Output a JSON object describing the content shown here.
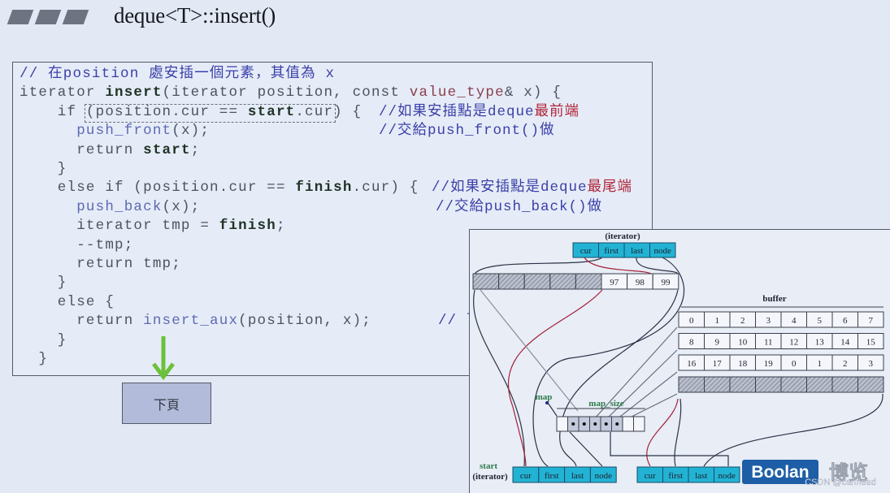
{
  "slide": {
    "title": "deque<T>::insert()",
    "next_button_label": "下頁"
  },
  "code": {
    "lines": [
      {
        "segs": [
          {
            "t": "// 在position 處安插一個元素，其值為 x",
            "c": "cm"
          }
        ]
      },
      {
        "segs": [
          {
            "t": "iterator "
          },
          {
            "t": "insert",
            "c": "b"
          },
          {
            "t": "(iterator position, const "
          },
          {
            "t": "value_type",
            "c": "ty"
          },
          {
            "t": "& x) {"
          }
        ]
      },
      {
        "segs": [
          {
            "t": "    if (position.cur == "
          },
          {
            "t": "start",
            "c": "b"
          },
          {
            "t": ".cur) {"
          }
        ],
        "comment": [
          {
            "t": "//如果安插點是deque"
          },
          {
            "t": "最前端",
            "c": "cmr"
          }
        ]
      },
      {
        "segs": [
          {
            "t": "      "
          },
          {
            "t": "push_front",
            "c": "fn"
          },
          {
            "t": "(x);"
          }
        ],
        "comment": [
          {
            "t": "//交給push_front()做"
          }
        ]
      },
      {
        "segs": [
          {
            "t": "      return "
          },
          {
            "t": "start",
            "c": "b"
          },
          {
            "t": ";"
          }
        ]
      },
      {
        "segs": [
          {
            "t": "    }"
          }
        ]
      },
      {
        "segs": [
          {
            "t": "    else if (position.cur == "
          },
          {
            "t": "finish",
            "c": "b"
          },
          {
            "t": ".cur) {"
          }
        ],
        "comment": [
          {
            "t": "//如果安插點是deque"
          },
          {
            "t": "最尾端",
            "c": "cmr"
          }
        ]
      },
      {
        "segs": [
          {
            "t": "      "
          },
          {
            "t": "push_back",
            "c": "fn"
          },
          {
            "t": "(x);"
          }
        ],
        "comment": [
          {
            "t": "//交給push_back()做"
          }
        ]
      },
      {
        "segs": [
          {
            "t": "      iterator tmp = "
          },
          {
            "t": "finish",
            "c": "b"
          },
          {
            "t": ";"
          }
        ]
      },
      {
        "segs": [
          {
            "t": "      --tmp;"
          }
        ]
      },
      {
        "segs": [
          {
            "t": "      return tmp;"
          }
        ]
      },
      {
        "segs": [
          {
            "t": "    }"
          }
        ]
      },
      {
        "segs": [
          {
            "t": "    else {"
          }
        ]
      },
      {
        "segs": [
          {
            "t": "      return "
          },
          {
            "t": "insert_aux",
            "c": "fn"
          },
          {
            "t": "(position, x);"
          }
        ],
        "comment": [
          {
            "t": "// 了"
          }
        ]
      },
      {
        "segs": [
          {
            "t": "    }"
          }
        ]
      },
      {
        "segs": [
          {
            "t": "  }"
          }
        ]
      }
    ]
  },
  "diagram": {
    "top_iterator_label": "(iterator)",
    "iterator_fields": [
      "cur",
      "first",
      "last",
      "node"
    ],
    "top_buffer_values": [
      "",
      "",
      "",
      "",
      "",
      "97",
      "98",
      "99"
    ],
    "top_buffer_hatched": [
      true,
      true,
      true,
      true,
      true,
      false,
      false,
      false
    ],
    "buffer_label": "buffer",
    "buffer_rows": [
      [
        "0",
        "1",
        "2",
        "3",
        "4",
        "5",
        "6",
        "7"
      ],
      [
        "8",
        "9",
        "10",
        "11",
        "12",
        "13",
        "14",
        "15"
      ],
      [
        "16",
        "17",
        "18",
        "19",
        "0",
        "1",
        "2",
        "3"
      ]
    ],
    "map_label": "map",
    "map_size_label": "map_size",
    "map_used_cells": [
      false,
      true,
      true,
      true,
      true,
      true,
      false,
      false
    ],
    "start_label": "start",
    "start_sub_label": "(iterator)",
    "logo_text": "Boolan",
    "logo_cn": "博览",
    "watermark": "CSDN @canneed",
    "colors": {
      "iterator_cell": "#22b3d4",
      "logo_bg": "#1d5ea6",
      "label_green": "#2f7a4c",
      "ptr_red": "#a3203a",
      "ptr_dark": "#2a3244"
    }
  }
}
